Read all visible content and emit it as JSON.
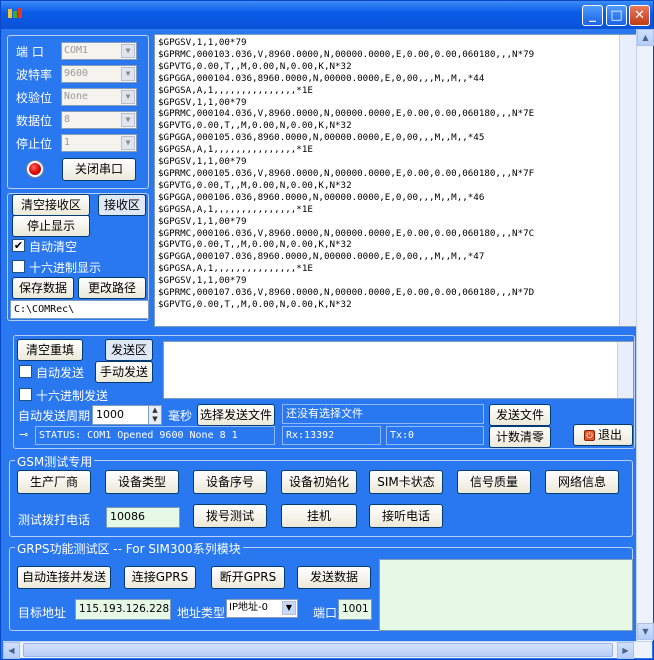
{
  "window": {
    "minimize": "_",
    "maximize": "□",
    "close": "✕"
  },
  "port_settings": {
    "port_label": "端  口",
    "port_value": "COM1",
    "baud_label": "波特率",
    "baud_value": "9600",
    "parity_label": "校验位",
    "parity_value": "None",
    "databits_label": "数据位",
    "databits_value": "8",
    "stopbits_label": "停止位",
    "stopbits_value": "1",
    "close_port": "关闭串口"
  },
  "receive": {
    "clear_button": "清空接收区",
    "area_button": "接收区",
    "stop_display": "停止显示",
    "auto_clear": "自动清空",
    "hex_display": "十六进制显示",
    "save_data": "保存数据",
    "change_path": "更改路径",
    "path": "C:\\COMRec\\"
  },
  "log_lines": [
    "$GPGSV,1,1,00*79",
    "$GPRMC,000103.036,V,8960.0000,N,00000.0000,E,0.00,0.00,060180,,,N*79",
    "$GPVTG,0.00,T,,M,0.00,N,0.00,K,N*32",
    "$GPGGA,000104.036,8960.0000,N,00000.0000,E,0,00,,,M,,M,,*44",
    "$GPGSA,A,1,,,,,,,,,,,,,,,*1E",
    "$GPGSV,1,1,00*79",
    "$GPRMC,000104.036,V,8960.0000,N,00000.0000,E,0.00,0.00,060180,,,N*7E",
    "$GPVTG,0.00,T,,M,0.00,N,0.00,K,N*32",
    "$GPGGA,000105.036,8960.0000,N,00000.0000,E,0,00,,,M,,M,,*45",
    "$GPGSA,A,1,,,,,,,,,,,,,,,*1E",
    "$GPGSV,1,1,00*79",
    "$GPRMC,000105.036,V,8960.0000,N,00000.0000,E,0.00,0.00,060180,,,N*7F",
    "$GPVTG,0.00,T,,M,0.00,N,0.00,K,N*32",
    "$GPGGA,000106.036,8960.0000,N,00000.0000,E,0,00,,,M,,M,,*46",
    "$GPGSA,A,1,,,,,,,,,,,,,,,*1E",
    "$GPGSV,1,1,00*79",
    "$GPRMC,000106.036,V,8960.0000,N,00000.0000,E,0.00,0.00,060180,,,N*7C",
    "$GPVTG,0.00,T,,M,0.00,N,0.00,K,N*32",
    "$GPGGA,000107.036,8960.0000,N,00000.0000,E,0,00,,,M,,M,,*47",
    "$GPGSA,A,1,,,,,,,,,,,,,,,*1E",
    "$GPGSV,1,1,00*79",
    "$GPRMC,000107.036,V,8960.0000,N,00000.0000,E,0.00,0.00,060180,,,N*7D",
    "$GPVTG,0.00,T,,M,0.00,N,0.00,K,N*32"
  ],
  "send": {
    "clear_resend": "清空重填",
    "area_button": "发送区",
    "auto_send": "自动发送",
    "manual_send": "手动发送",
    "hex_send": "十六进制发送",
    "period_label": "自动发送周期",
    "period_value": "1000",
    "ms_label": "毫秒",
    "select_file": "选择发送文件",
    "file_status": "还没有选择文件",
    "send_file": "发送文件",
    "count_clear": "计数清零",
    "exit": "退出"
  },
  "status": {
    "text": "STATUS: COM1 Opened 9600 None 8 1",
    "rx": "Rx:13392",
    "tx": "Tx:0"
  },
  "gsm": {
    "title": "GSM测试专用",
    "manufacturer": "生产厂商",
    "device_type": "设备类型",
    "device_serial": "设备序号",
    "device_init": "设备初始化",
    "sim_status": "SIM卡状态",
    "signal_quality": "信号质量",
    "network_info": "网络信息",
    "dial_label": "测试拨打电话",
    "dial_number": "10086",
    "dial_test": "拨号测试",
    "hang_up": "挂机",
    "answer_call": "接听电话"
  },
  "gprs": {
    "title": "GRPS功能测试区 -- For SIM300系列模块",
    "auto_connect_send": "自动连接并发送",
    "connect": "连接GPRS",
    "disconnect": "断开GPRS",
    "send_data": "发送数据",
    "target_label": "目标地址",
    "target_value": "115.193.126.228",
    "addr_type_label": "地址类型",
    "addr_type_value": "IP地址-0",
    "port_label": "端口",
    "port_value": "1001"
  },
  "colors": {
    "window_bg": "#2a78f0",
    "title_bar": "#0b5ce8",
    "led": "#e00000"
  }
}
